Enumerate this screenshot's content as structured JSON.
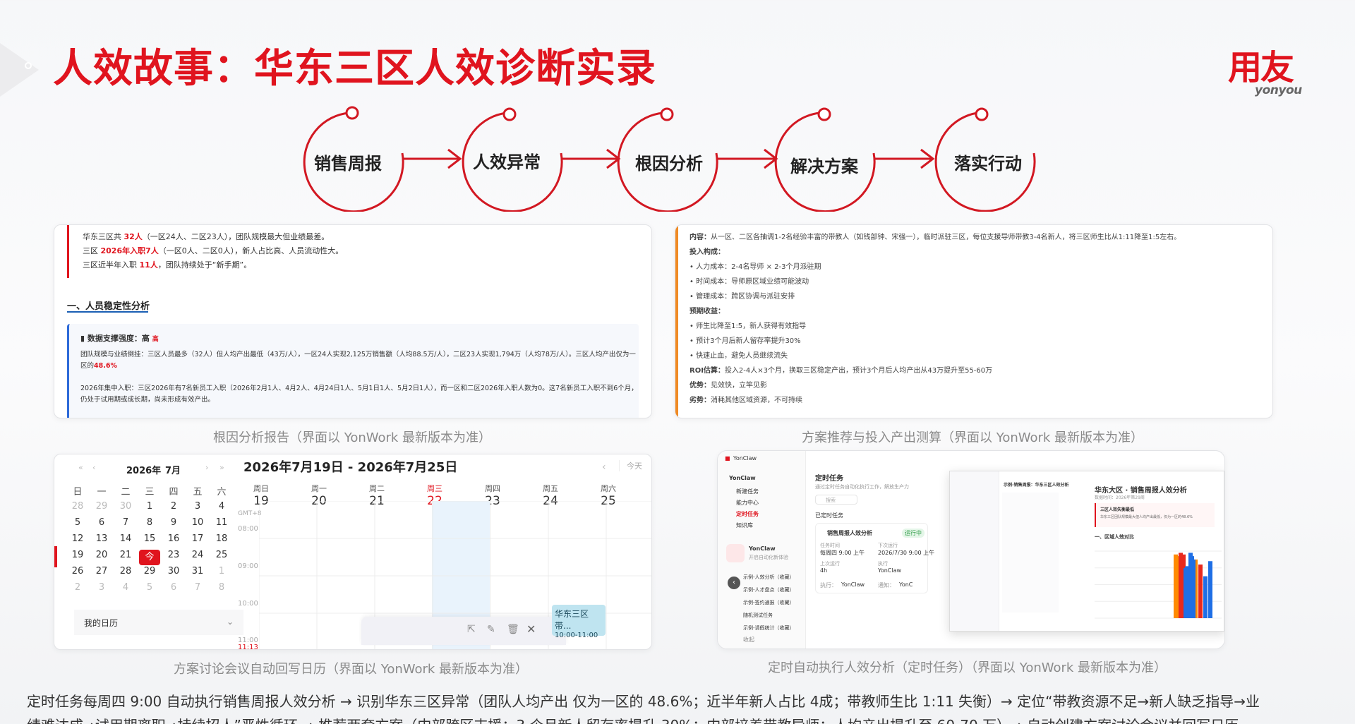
{
  "title": "人效故事：华东三区人效诊断实录",
  "logo": {
    "cn": "用友",
    "en": "yonyou"
  },
  "flow": [
    "销售周报",
    "人效异常",
    "根因分析",
    "解决方案",
    "落实行动"
  ],
  "panel1": {
    "lines": [
      {
        "pre": "华东三区共 ",
        "hl": "32人",
        "post": "（一区24人、二区23人），团队规模最大但业绩最差。"
      },
      {
        "pre": "三区 ",
        "hl": "2026年入职7人",
        "post": "（一区0人、二区0人），新人占比高、人员流动性大。"
      },
      {
        "pre": "三区近半年入职 ",
        "hl": "11人",
        "post": "，团队持续处于“新手期”。"
      }
    ],
    "heading": "一、人员稳定性分析",
    "box_title": "数据支撑强度：高",
    "box_tag": "高",
    "box_p1a": "团队规模与业绩倒挂：三区人员最多（32人）但人均产出最低（43万/人），一区24人实现2,125万销售额（人均88.5万/人），二区23人实现1,794万（人均78万/人）。三区人均产出仅为一区的",
    "box_p1b": "48.6%",
    "box_p2a": "2026年集中入职：三区2026年有7名新员工入职（2026年2月1人、4月2人、4月24日1人、5月1日1人、5月2日1人），而一区和二区2026年入职人数为0。这7名新员工入职不到6个月，仍处于试用期或",
    "box_p2b": "成长期，尚未形成有效产出。"
  },
  "caption1": "根因分析报告（界面以 YonWork 最新版本为准）",
  "panel2": {
    "lines": [
      {
        "b": "内容：",
        "t": "从一区、二区各抽调1-2名经验丰富的带教人（如钱部钟、宋强一），临时派驻三区，每位支援导师带教3-4名新人，将三区师生比从1:11降至1:5左右。"
      },
      {
        "b": "投入构成：",
        "t": ""
      },
      {
        "b": "",
        "t": "• 人力成本：2-4名导师 × 2-3个月派驻期"
      },
      {
        "b": "",
        "t": "• 时间成本：导师原区域业绩可能波动"
      },
      {
        "b": "",
        "t": "• 管理成本：跨区协调与派驻安排"
      },
      {
        "b": "预期收益：",
        "t": ""
      },
      {
        "b": "",
        "t": "• 师生比降至1:5，新人获得有效指导"
      },
      {
        "b": "",
        "t": "• 预计3个月后新人留存率提升30%"
      },
      {
        "b": "",
        "t": "• 快速止血，避免人员继续流失"
      },
      {
        "b": "ROI估算：",
        "t": "投入2-4人×3个月，换取三区稳定产出，预计3个月后人均产出从43万提升至55-60万"
      },
      {
        "b": "优势：",
        "t": "见效快，立竿见影"
      },
      {
        "b": "劣势：",
        "t": "消耗其他区域资源，不可持续"
      }
    ]
  },
  "caption2": "方案推荐与投入产出测算（界面以 YonWork 最新版本为准）",
  "calendar": {
    "mini_year": "2026年",
    "mini_month": "7月",
    "weekdays": [
      "日",
      "一",
      "二",
      "三",
      "四",
      "五",
      "六"
    ],
    "rows": [
      [
        "28",
        "29",
        "30",
        "1",
        "2",
        "3",
        "4"
      ],
      [
        "5",
        "6",
        "7",
        "8",
        "9",
        "10",
        "11"
      ],
      [
        "12",
        "13",
        "14",
        "15",
        "16",
        "17",
        "18"
      ],
      [
        "19",
        "20",
        "21",
        "今",
        "23",
        "24",
        "25"
      ],
      [
        "26",
        "27",
        "28",
        "29",
        "30",
        "31",
        "1"
      ],
      [
        "2",
        "3",
        "4",
        "5",
        "6",
        "7",
        "8"
      ]
    ],
    "my_calendar": "我的日历",
    "range": "2026年7月19日 - 2026年7月25日",
    "today_btn": "今天",
    "gmt": "GMT+8",
    "day_names": [
      "周日",
      "周一",
      "周二",
      "周三",
      "周四",
      "周五",
      "周六"
    ],
    "day_nums": [
      "19",
      "20",
      "21",
      "22",
      "23",
      "24",
      "25"
    ],
    "hours": [
      "08:00",
      "09:00",
      "10:00",
      "11:00"
    ],
    "now_time": "11:13",
    "event_title": "华东三区带...",
    "event_time": "10:00-11:00"
  },
  "caption3": "方案讨论会议自动回写日历（界面以 YonWork 最新版本为准）",
  "yonclaw": {
    "app": "YonClaw",
    "app2": "YonClaw",
    "menu": [
      "新建任务",
      "能力中心",
      "定时任务",
      "知识库"
    ],
    "side_title": "YonClaw",
    "side_sub": "开启自动化新体验",
    "side_items": [
      "示例-人效分析（收藏）",
      "示例-人才盘点（收藏）",
      "示例-签约通报（收藏）",
      "随机测试任务",
      "示例-请假统计（收藏）"
    ],
    "collapse": "收起",
    "section": "定时任务",
    "section_sub": "通过定时任务自动化执行工作，解放生产力",
    "search": "搜索",
    "created": "已定时任务",
    "task_name": "销售周报人效分析",
    "task_status": "运行中",
    "f_freq_l": "任务时间",
    "f_freq": "每周四 9:00 上午",
    "f_next_l": "下次运行",
    "f_next": "2026/7/30 9:00 上午",
    "f_last_l": "上次运行",
    "f_last": "4h",
    "f_by_l": "执行",
    "f_by": "YonClaw",
    "exec_l": "执行：",
    "exec_v": "YonClaw",
    "notify_l": "通知：",
    "notify_v": "YonC",
    "report_title": "华东大区 · 销售周报人效分析",
    "report_sub": "数据时间：2026年第29周",
    "report_box_title": "三区人效失衡最低",
    "report_box_text": "华东三区团队规模最大但人均产出最低，仅为一区的48.6%",
    "report_h": "一、区域人效对比",
    "chat_title": "示例-销售周报：华东三区人效分析"
  },
  "caption4": "定时自动执行人效分析（定时任务）（界面以 YonWork 最新版本为准）",
  "bottom_text_1": "定时任务每周四 9:00 自动执行销售周报人效分析 → 识别华东三区异常（团队人均产出 仅为一区的 48.6%；近半年新人占比 4成；带教师生比 1:11 失衡）→ 定位“带教资源不足→新人缺乏指导→业",
  "bottom_text_2": "绩难达成→试用期离职→持续招人”恶性循环 → 推荐两套方案（中部跨区支援：3 个月新人留存率提升 30%；内部培养带教导师：人均产出提升至 60-70 万）→ 自动创建方案讨论会议并回写日历",
  "colors": {
    "brand_red": "#e0141e",
    "accent_blue": "#2d6ad8",
    "accent_orange": "#f08a24",
    "event_blue": "#bfe4f0"
  },
  "chart_data": {
    "type": "bar",
    "categories": [
      "",
      "",
      "",
      ""
    ],
    "series": [
      {
        "values": [
          3.5,
          3.8,
          3.7,
          3.3
        ]
      },
      {
        "values": [
          3.2,
          3.9,
          3.6,
          3.8
        ]
      },
      {
        "values": [
          2.5,
          3.0,
          3.1,
          2.3
        ]
      },
      {
        "values": [
          3.4,
          3.9,
          3.7,
          3.5
        ]
      }
    ],
    "series_colors": [
      "#ff8a00",
      "#e8291c",
      "#1f6fe5",
      "#1f6fe5"
    ],
    "ylim": [
      0,
      4
    ]
  }
}
